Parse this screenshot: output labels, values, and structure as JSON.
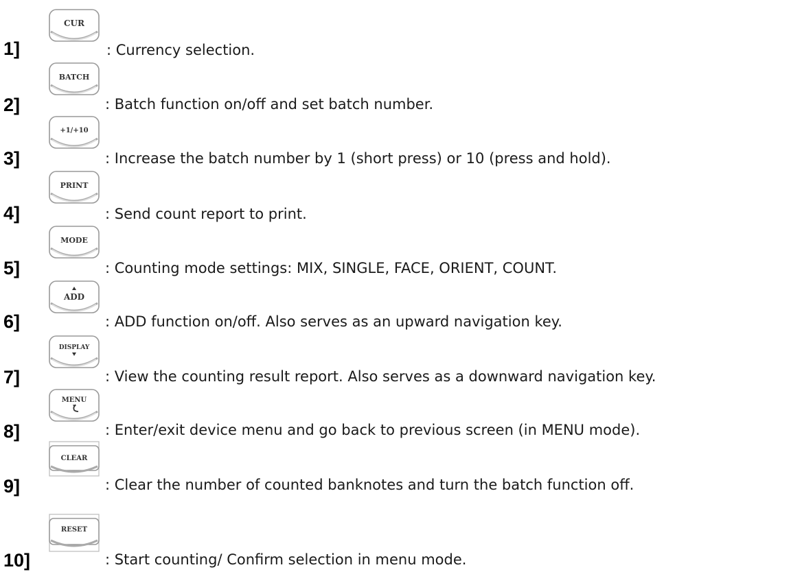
{
  "items": [
    {
      "num": "1]",
      "key_label": "CUR",
      "text": ": Currency selection."
    },
    {
      "num": "2]",
      "key_label": "BATCH",
      "text": ": Batch function on/off and set batch number."
    },
    {
      "num": "3]",
      "key_label": "+1/+10",
      "text": ": Increase the batch number by 1 (short press) or 10 (press and hold)."
    },
    {
      "num": "4]",
      "key_label": "PRINT",
      "text": ": Send count report to print."
    },
    {
      "num": "5]",
      "key_label": "MODE",
      "text": ": Counting mode settings: MIX, SINGLE, FACE, ORIENT, COUNT."
    },
    {
      "num": "6]",
      "key_label": "ADD",
      "text": ": ADD function on/off. Also serves as an upward navigation key."
    },
    {
      "num": "7]",
      "key_label": "DISPLAY",
      "text": ": View the counting result report. Also serves as a downward navigation key."
    },
    {
      "num": "8]",
      "key_label": "MENU",
      "text": ": Enter/exit device menu and go back to previous screen (in MENU mode)."
    },
    {
      "num": "9]",
      "key_label": "CLEAR",
      "text": ": Clear the number of counted banknotes and turn the batch function off."
    },
    {
      "num": "10]",
      "key_label": "RESET",
      "text": ": Start counting/ Confirm selection in menu mode."
    }
  ]
}
